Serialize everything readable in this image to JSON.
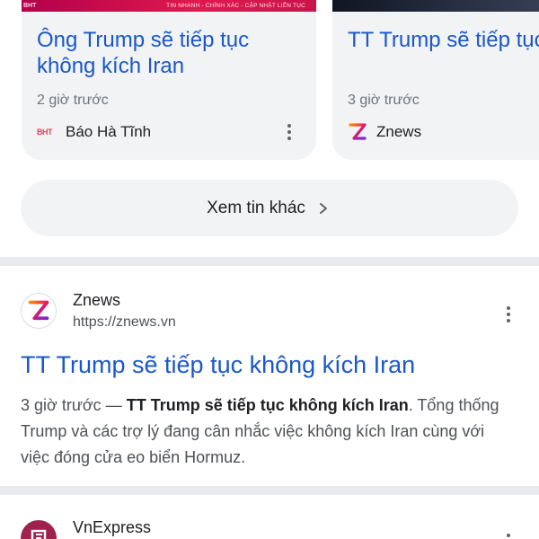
{
  "cards": [
    {
      "image_tag": "BHT",
      "image_ticker": "TIN NHANH - CHÍNH XÁC - CẬP NHẬT LIÊN TỤC",
      "title": "Ông Trump sẽ tiếp tục không kích Iran",
      "time": "2 giờ trước",
      "source": "Báo Hà Tĩnh",
      "source_logo": "BHT"
    },
    {
      "title": "TT Trump sẽ tiếp tục không kích Iran",
      "time": "3 giờ trước",
      "source": "Znews"
    }
  ],
  "more_button": {
    "label": "Xem tin khác"
  },
  "results": [
    {
      "site_name": "Znews",
      "url": "https://znews.vn",
      "title": "TT Trump sẽ tiếp tục không kích Iran",
      "time": "3 giờ trước",
      "separator": " — ",
      "bold": "TT Trump sẽ tiếp tục không kích Iran",
      "snippet": ". Tổng thống Trump và các trợ lý đang cân nhắc việc không kích Iran cùng với việc đóng cửa eo biển Hormuz."
    },
    {
      "site_name": "VnExpress"
    }
  ],
  "colors": {
    "link_blue": "#1a57c8",
    "card_bg": "#f1f3f4",
    "divider": "#e8eaed"
  }
}
